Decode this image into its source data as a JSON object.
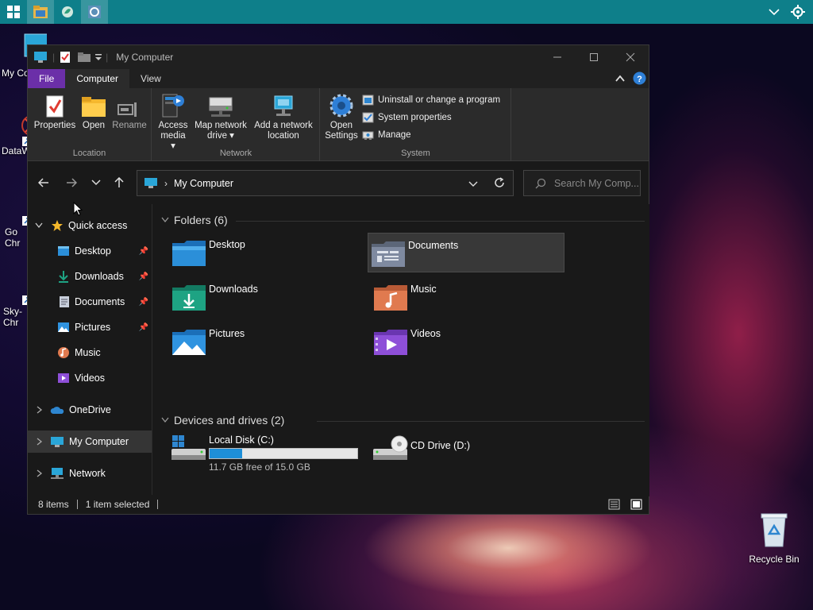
{
  "taskbar": {
    "right_icons": [
      "chevron-down-icon",
      "gear-icon"
    ]
  },
  "desktop": {
    "icons": [
      {
        "label": "My Co",
        "icon": "computer-icon"
      },
      {
        "label": "DataW",
        "icon": "app-shortcut-icon"
      },
      {
        "label": "Go Chr",
        "icon": "chrome-icon"
      },
      {
        "label": "Sky- Chr",
        "icon": "chrome-icon"
      },
      {
        "label": "Recycle Bin",
        "icon": "recycle-bin-icon"
      }
    ]
  },
  "window": {
    "title": "My Computer",
    "tabs": [
      {
        "label": "File"
      },
      {
        "label": "Computer"
      },
      {
        "label": "View"
      }
    ],
    "ribbon": {
      "location": {
        "label": "Location",
        "buttons": [
          {
            "label": "Properties"
          },
          {
            "label": "Open"
          },
          {
            "label": "Rename"
          }
        ]
      },
      "network": {
        "label": "Network",
        "buttons": [
          {
            "line1": "Access",
            "line2": "media ▾"
          },
          {
            "line1": "Map network",
            "line2": "drive ▾"
          },
          {
            "line1": "Add a network",
            "line2": "location"
          }
        ]
      },
      "system": {
        "label": "System",
        "open_settings": {
          "line1": "Open",
          "line2": "Settings"
        },
        "items": [
          {
            "label": "Uninstall or change a program"
          },
          {
            "label": "System properties"
          },
          {
            "label": "Manage"
          }
        ]
      }
    },
    "address": {
      "path": "My Computer",
      "search_placeholder": "Search My Comp..."
    },
    "sidebar": {
      "quick_access": "Quick access",
      "items": [
        {
          "label": "Desktop",
          "pinned": true
        },
        {
          "label": "Downloads",
          "pinned": true
        },
        {
          "label": "Documents",
          "pinned": true
        },
        {
          "label": "Pictures",
          "pinned": true
        },
        {
          "label": "Music",
          "pinned": false
        },
        {
          "label": "Videos",
          "pinned": false
        }
      ],
      "onedrive": "OneDrive",
      "my_computer": "My Computer",
      "network": "Network"
    },
    "content": {
      "folders_header": "Folders (6)",
      "folders": [
        {
          "name": "Desktop",
          "color": "#2b8fd9"
        },
        {
          "name": "Documents",
          "color": "#7f8aa0"
        },
        {
          "name": "Downloads",
          "color": "#1ea383"
        },
        {
          "name": "Music",
          "color": "#e07a4f"
        },
        {
          "name": "Pictures",
          "color": "#2f93e0"
        },
        {
          "name": "Videos",
          "color": "#8e4fd8"
        }
      ],
      "drives_header": "Devices and drives (2)",
      "drives": [
        {
          "name": "Local Disk (C:)",
          "free_text": "11.7 GB free of 15.0 GB",
          "used_fraction": 0.22
        },
        {
          "name": "CD Drive (D:)"
        }
      ]
    },
    "status": {
      "items": "8 items",
      "selected": "1 item selected"
    }
  },
  "colors": {
    "accent_file_tab": "#6b2fa8",
    "taskbar": "#0e7f8a",
    "drive_bar": "#1e8fd8"
  }
}
